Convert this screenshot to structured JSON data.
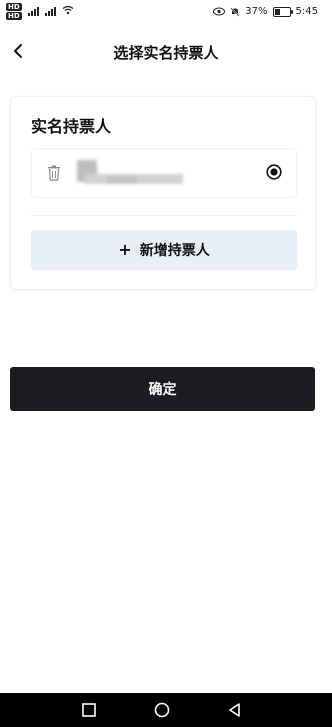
{
  "status_bar": {
    "hd_badges": [
      "HD",
      "HD"
    ],
    "net_labels": [
      "4G",
      "5G"
    ],
    "battery_percent": 37,
    "battery_text": "37%",
    "time": "5:45"
  },
  "header": {
    "title": "选择实名持票人",
    "back_icon": "chevron-left-icon"
  },
  "holders_card": {
    "title": "实名持票人",
    "holders": [
      {
        "name_blurred": true,
        "selected": true,
        "delete_icon": "trash-icon",
        "radio_icon": "radio-checked-icon"
      }
    ],
    "add_button": {
      "icon": "plus-icon",
      "label": "新增持票人"
    }
  },
  "confirm_button": {
    "label": "确定"
  },
  "system_nav": {
    "buttons": [
      "square-icon",
      "circle-icon",
      "triangle-back-icon"
    ]
  },
  "colors": {
    "accent_button_bg": "#1b1c1f",
    "add_button_bg": "#e9eff9",
    "nav_bar_bg": "#000000"
  }
}
